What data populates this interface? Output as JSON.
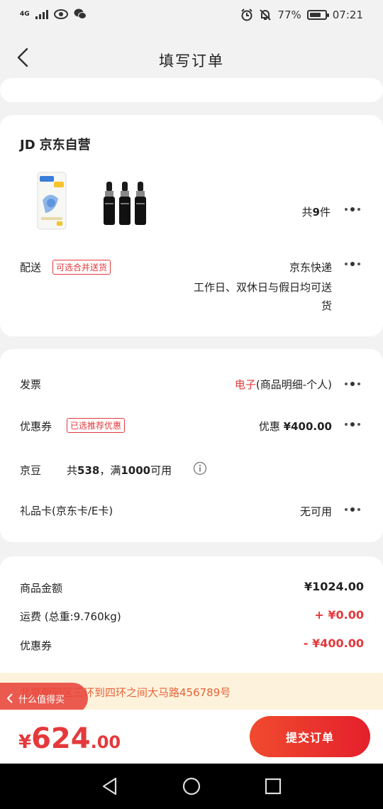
{
  "status": {
    "network": "4G",
    "battery": "77%",
    "battery_level": 0.77,
    "time": "07:21"
  },
  "header": {
    "title": "填写订单"
  },
  "store": {
    "brand": "JD",
    "name": "京东自营",
    "count_prefix": "共",
    "count": "9",
    "count_suffix": "件",
    "delivery_label": "配送",
    "delivery_tag": "可选合并送货",
    "delivery_method": "京东快递",
    "delivery_time_line1": "工作日、双休日与假日均可送",
    "delivery_time_line2": "货"
  },
  "options": {
    "invoice_label": "发票",
    "invoice_type": "电子",
    "invoice_detail": "(商品明细-个人)",
    "coupon_label": "优惠券",
    "coupon_tag": "已选推荐优惠",
    "coupon_value_prefix": "优惠",
    "coupon_value": "¥400.00",
    "beans_label": "京豆",
    "beans_pre": "共",
    "beans_count": "538",
    "beans_mid": "，满",
    "beans_min": "1000",
    "beans_post": "可用",
    "giftcard_label": "礼品卡(京东卡/E卡)",
    "giftcard_value": "无可用"
  },
  "summary": {
    "goods_label": "商品金额",
    "goods_value": "¥1024.00",
    "shipping_label": "运费 (总重:9.760kg)",
    "shipping_value": "+ ¥0.00",
    "coupon_label": "优惠券",
    "coupon_value": "- ¥400.00"
  },
  "address": {
    "text": "北京朝阳区三环到四环之间大马路456789号",
    "help_label": "什么值得买"
  },
  "footer": {
    "yen": "¥",
    "total_int": "624",
    "total_dec": ".00",
    "submit_label": "提交订单"
  },
  "colors": {
    "accent": "#e4393c",
    "address_bg": "#fdf3dc",
    "address_text": "#e8623a"
  }
}
